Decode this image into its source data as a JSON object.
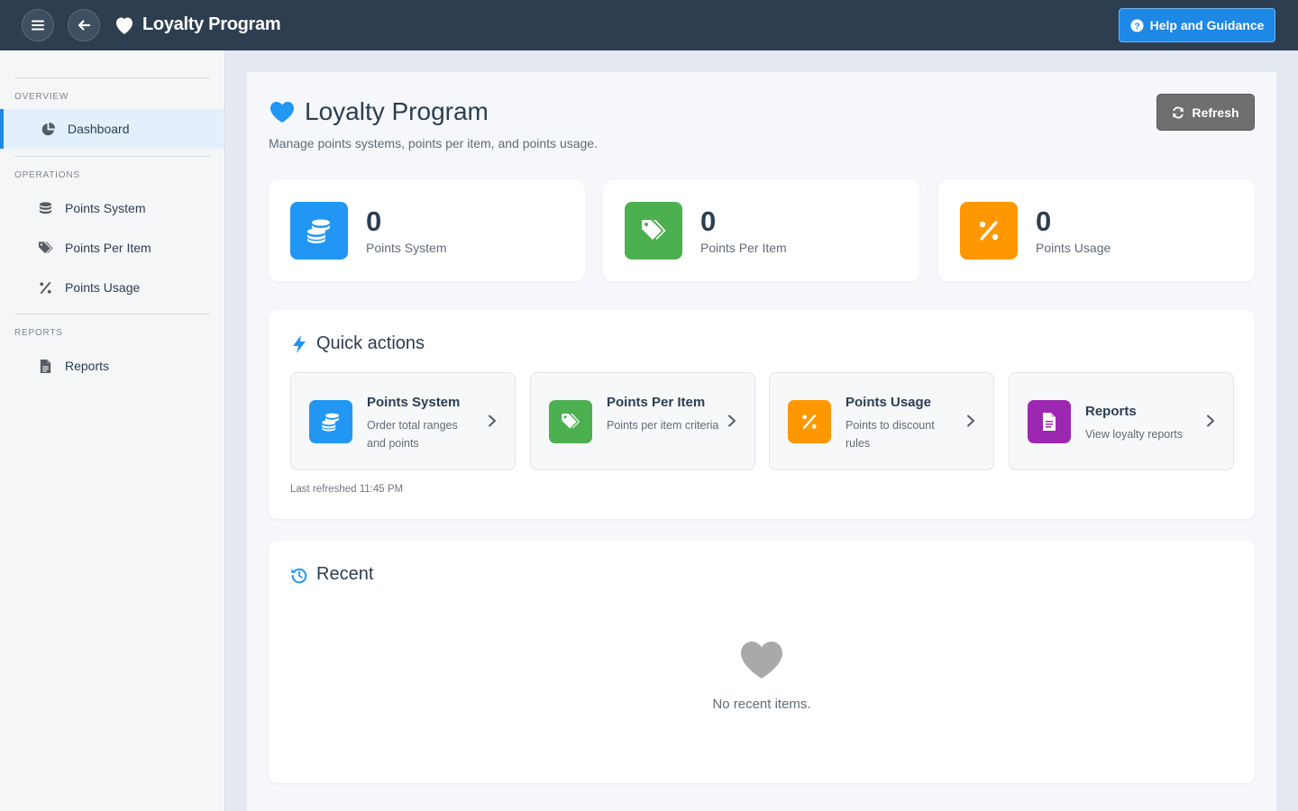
{
  "topbar": {
    "title": "Loyalty Program",
    "help_label": "Help and Guidance"
  },
  "sidebar": {
    "sections": [
      {
        "label": "OVERVIEW"
      },
      {
        "label": "OPERATIONS"
      },
      {
        "label": "REPORTS"
      }
    ],
    "items": [
      {
        "label": "Dashboard",
        "icon": "pie-chart-icon"
      },
      {
        "label": "Points System",
        "icon": "coins-icon"
      },
      {
        "label": "Points Per Item",
        "icon": "tags-icon"
      },
      {
        "label": "Points Usage",
        "icon": "percent-icon"
      },
      {
        "label": "Reports",
        "icon": "file-icon"
      }
    ]
  },
  "page": {
    "title": "Loyalty Program",
    "subtitle": "Manage points systems, points per item, and points usage.",
    "refresh_label": "Refresh"
  },
  "stats": [
    {
      "value": "0",
      "label": "Points System",
      "color": "#2196f3",
      "icon": "coins-icon"
    },
    {
      "value": "0",
      "label": "Points Per Item",
      "color": "#4caf50",
      "icon": "tags-icon"
    },
    {
      "value": "0",
      "label": "Points Usage",
      "color": "#ff9800",
      "icon": "percent-icon"
    }
  ],
  "quick_actions": {
    "title": "Quick actions",
    "items": [
      {
        "title": "Points System",
        "desc": "Order total ranges and points",
        "color": "#2196f3",
        "icon": "coins-icon"
      },
      {
        "title": "Points Per Item",
        "desc": "Points per item criteria",
        "color": "#4caf50",
        "icon": "tags-icon"
      },
      {
        "title": "Points Usage",
        "desc": "Points to discount rules",
        "color": "#ff9800",
        "icon": "percent-icon"
      },
      {
        "title": "Reports",
        "desc": "View loyalty reports",
        "color": "#9c27b0",
        "icon": "file-icon"
      }
    ],
    "last_refreshed": "Last refreshed 11:45 PM"
  },
  "recent": {
    "title": "Recent",
    "empty_text": "No recent items."
  }
}
